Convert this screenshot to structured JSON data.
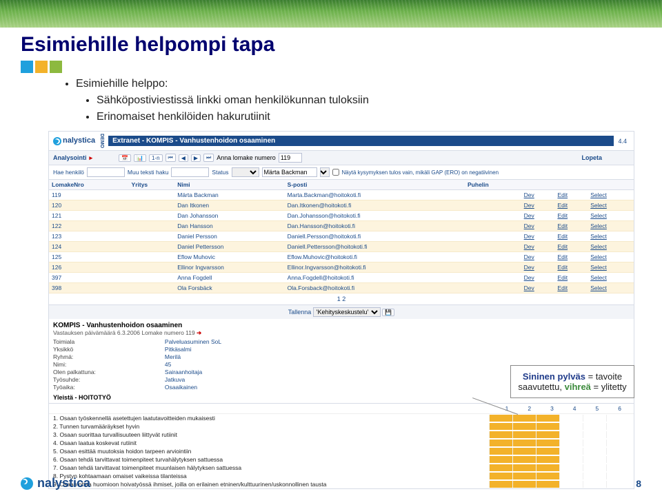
{
  "slide": {
    "title": "Esimiehille helpompi tapa",
    "bullets": [
      "Esimiehille helppo:",
      "Sähköpostiviestissä linkki oman henkilökunnan tuloksiin",
      "Erinomaiset henkilöiden hakurutiinit"
    ]
  },
  "app": {
    "brand": "nalystica",
    "demo": "DEMO",
    "extranet": "Extranet - KOMPIS - Vanhustenhoidon osaaminen",
    "version": "4.4",
    "toolbar": {
      "analysointi": "Analysointi",
      "anna_lomake": "Anna lomake numero",
      "lomake_val": "119",
      "lopeta": "Lopeta",
      "n1n": "1-n"
    },
    "filters": {
      "hae": "Hae henkilö",
      "muu": "Muu teksti haku",
      "status": "Status",
      "name_val": "Märta Backman",
      "nayta": "Näytä kysymyksen tulos vain, mikäli GAP (ERO) on negatiivinen"
    },
    "columns": [
      "LomakeNro",
      "Yritys",
      "Nimi",
      "S-posti",
      "Puhelin",
      "",
      "",
      ""
    ],
    "actions": {
      "dev": "Dev",
      "edit": "Edit",
      "select": "Select"
    },
    "rows": [
      {
        "n": "119",
        "nimi": "Märta Backman",
        "em": "Marta.Backman@hoitokoti.fi"
      },
      {
        "n": "120",
        "nimi": "Dan Itkonen",
        "em": "Dan.Itkonen@hoitokoti.fi"
      },
      {
        "n": "121",
        "nimi": "Dan Johansson",
        "em": "Dan.Johansson@hoitokoti.fi"
      },
      {
        "n": "122",
        "nimi": "Dan Hansson",
        "em": "Dan.Hansson@hoitokoti.fi"
      },
      {
        "n": "123",
        "nimi": "Daniel Persson",
        "em": "Daniell.Persson@hoitokoti.fi"
      },
      {
        "n": "124",
        "nimi": "Daniel Pettersson",
        "em": "Daniell.Pettersson@hoitokoti.fi"
      },
      {
        "n": "125",
        "nimi": "Eflow Muhovic",
        "em": "Eflow.Muhovic@hoitokoti.fi"
      },
      {
        "n": "126",
        "nimi": "Ellinor Ingvarsson",
        "em": "Ellinor.Ingvarsson@hoitokoti.fi"
      },
      {
        "n": "397",
        "nimi": "Anna Fogdell",
        "em": "Anna.Fogdell@hoitokoti.fi"
      },
      {
        "n": "398",
        "nimi": "Ola Forsbäck",
        "em": "Ola.Forsback@hoitokoti.fi"
      }
    ],
    "pager": "1 2",
    "tallenna_lbl": "Tallenna",
    "tallenna_opt": "'Kehityskeskustelu'",
    "kompis": "KOMPIS - Vanhustenhoidon osaaminen",
    "vastauksen": "Vastauksen päivämäärä 6.3.2006 Lomake numero 119",
    "detailsL": [
      [
        "Toimiala",
        ""
      ],
      [
        "Yksikkö",
        ""
      ],
      [
        "Ryhmä:",
        ""
      ],
      [
        "Nimi:",
        ""
      ],
      [
        "Olen palkattuna:",
        ""
      ],
      [
        "Työsuhde:",
        ""
      ],
      [
        "Työaika:",
        ""
      ]
    ],
    "detailsR": [
      [
        "Palveluasuminen SoL"
      ],
      [
        "Pitkäsalmi"
      ],
      [
        "Merilä"
      ],
      [
        "45"
      ],
      [
        "Sairaanhoitaja"
      ],
      [
        "Jatkuva"
      ],
      [
        "Osaaikainen"
      ]
    ],
    "yl": "Yleistä - HOITOTYÖ",
    "bar_hdr": [
      "1",
      "2",
      "3",
      "4",
      "5",
      "6"
    ],
    "questions": [
      "1. Osaan työskennellä asetettujen laatutavoitteiden mukaisesti",
      "2. Tunnen turvamääräykset hyvin",
      "3. Osaan suorittaa turvallisuuteen liittyvät rutiinit",
      "4. Osaan laatua koskevat rutiinit",
      "5. Osaan esittää muutoksia hoidon tarpeen arviointiin",
      "6. Osaan tehdä tarvittavat toimenpiteet turvahälytyksen sattuessa",
      "7. Osaan tehdä tarvittavat toimenpiteet muunlaisen hälytyksen sattuessa",
      "8. Pystyn kohtaamaan omaiset vaikeissa tilanteissa",
      "9. Osaan ottaa huomioon hoivatyössä ihmiset, joilla on erilainen etninen/kulttuurinen/uskonnollinen tausta"
    ]
  },
  "callout": {
    "line1a": "Sininen pylväs",
    "line1b": " = tavoite saavutettu, ",
    "line2a": "vihreä",
    "line2b": " = ylitetty"
  },
  "footer": {
    "brand": "nalystica",
    "page": "8"
  }
}
